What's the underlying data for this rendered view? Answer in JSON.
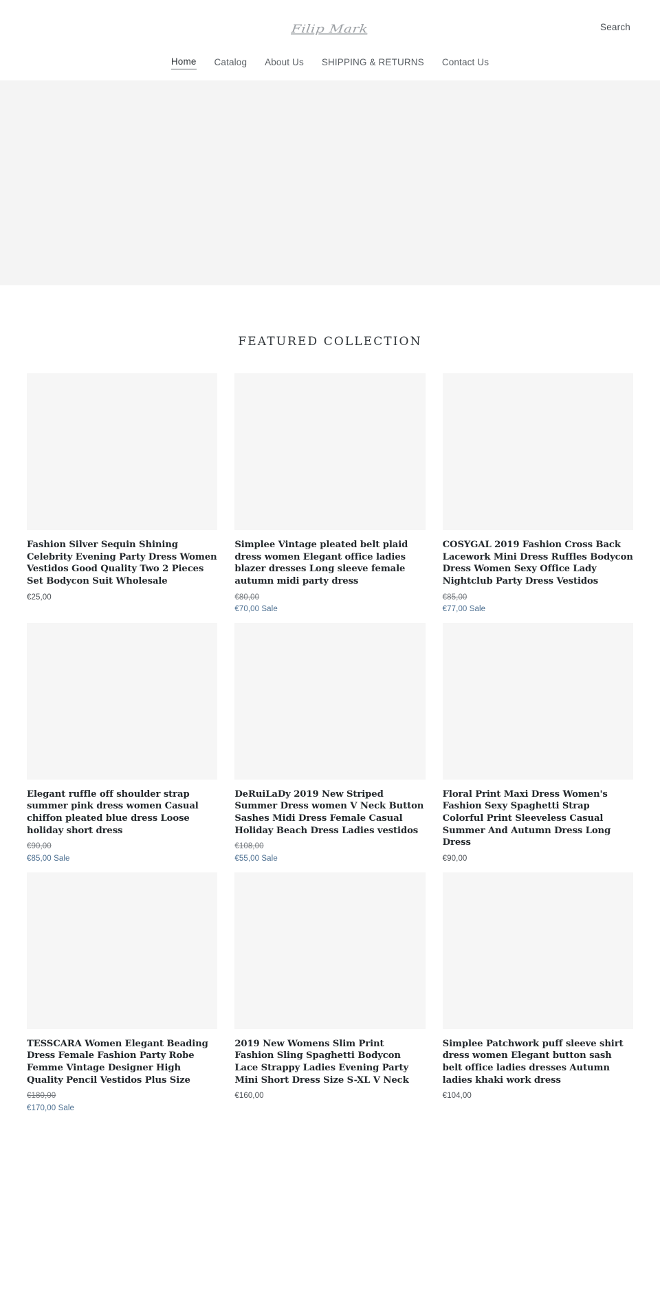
{
  "header": {
    "logo_text": "Filip Mark",
    "search_label": "Search",
    "nav": [
      {
        "label": "Home",
        "active": true
      },
      {
        "label": "Catalog",
        "active": false
      },
      {
        "label": "About Us",
        "active": false
      },
      {
        "label": "SHIPPING & RETURNS",
        "active": false
      },
      {
        "label": "Contact Us",
        "active": false
      }
    ]
  },
  "hero": {
    "background_color": "#f4f4f4"
  },
  "featured": {
    "heading": "FEATURED COLLECTION",
    "sale_word": "Sale",
    "accent_sale_color": "#4b6e90",
    "thumb_color": "#f6f6f6",
    "products": [
      {
        "title": "Fashion Silver Sequin Shining Celebrity Evening Party Dress Women Vestidos Good Quality Two 2 Pieces Set Bodycon Suit Wholesale",
        "price": "€25,00",
        "compare_at": null,
        "on_sale": false
      },
      {
        "title": "Simplee Vintage pleated belt plaid dress women Elegant office ladies blazer dresses Long sleeve female autumn midi party dress",
        "price": "€70,00",
        "compare_at": "€80,00",
        "on_sale": true
      },
      {
        "title": "COSYGAL 2019 Fashion Cross Back Lacework Mini Dress Ruffles Bodycon Dress Women Sexy Office Lady Nightclub Party Dress Vestidos",
        "price": "€77,00",
        "compare_at": "€85,00",
        "on_sale": true
      },
      {
        "title": "Elegant ruffle off shoulder strap summer pink dress women Casual chiffon pleated blue dress Loose holiday short dress",
        "price": "€85,00",
        "compare_at": "€90,00",
        "on_sale": true
      },
      {
        "title": "DeRuiLaDy 2019 New Striped Summer Dress women V Neck Button Sashes Midi Dress Female Casual Holiday Beach Dress Ladies vestidos",
        "price": "€55,00",
        "compare_at": "€108,00",
        "on_sale": true
      },
      {
        "title": "Floral Print Maxi Dress Women's Fashion Sexy Spaghetti Strap Colorful Print Sleeveless Casual Summer And Autumn Dress Long Dress",
        "price": "€90,00",
        "compare_at": null,
        "on_sale": false
      },
      {
        "title": "TESSCARA Women Elegant Beading Dress Female Fashion Party Robe Femme Vintage Designer High Quality Pencil Vestidos Plus Size",
        "price": "€170,00",
        "compare_at": "€180,00",
        "on_sale": true
      },
      {
        "title": "2019 New Womens Slim Print Fashion Sling Spaghetti Bodycon Lace Strappy Ladies Evening Party Mini Short Dress Size S-XL V Neck",
        "price": "€160,00",
        "compare_at": null,
        "on_sale": false
      },
      {
        "title": "Simplee Patchwork puff sleeve shirt dress women Elegant button sash belt office ladies dresses Autumn ladies khaki work dress",
        "price": "€104,00",
        "compare_at": null,
        "on_sale": false
      }
    ]
  }
}
